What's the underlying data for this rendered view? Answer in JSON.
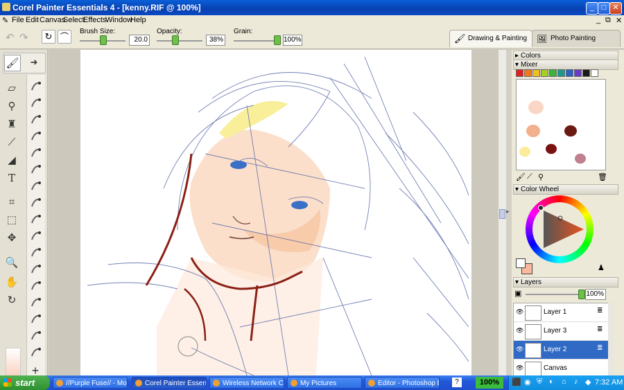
{
  "window": {
    "title": "Corel Painter Essentials 4 - [kenny.RIF @ 100%]"
  },
  "menu": [
    "File",
    "Edit",
    "Canvas",
    "Select",
    "Effects",
    "Window",
    "Help"
  ],
  "properties": {
    "brush_size_label": "Brush Size:",
    "brush_size_value": "20.0",
    "brush_size_level": 0.5,
    "opacity_label": "Opacity:",
    "opacity_value": "38%",
    "opacity_level": 0.38,
    "grain_label": "Grain:",
    "grain_value": "100%",
    "grain_level": 1.0
  },
  "workspace_tabs": [
    {
      "label": "Drawing & Painting",
      "active": true
    },
    {
      "label": "Photo Painting",
      "active": false
    }
  ],
  "tools": [
    "brush-tool-icon",
    "eraser-icon",
    "dropper-icon",
    "bucket-icon",
    "text-icon",
    "crop-icon",
    "rectangle-select-icon",
    "transform-icon",
    "magnifier-icon",
    "grabber-hand-icon",
    "rotate-page-icon"
  ],
  "panels": {
    "colors_title": "Colors",
    "mixer_title": "Mixer",
    "mixer_colors": [
      "#e02020",
      "#f07a1a",
      "#f0c020",
      "#a8d020",
      "#3cb43c",
      "#1e9a8c",
      "#2a62c8",
      "#6a3cc0",
      "#1a1a1a",
      "#ffffff"
    ],
    "mixer_blobs": [
      "#f9d7c4",
      "#f2b08e",
      "#6b1a12",
      "#7a1210",
      "#fbeb9a",
      "#c08090"
    ],
    "color_wheel_title": "Color Wheel",
    "main_color": "#e8541e",
    "secondary_color": "#f9b99e",
    "layers_title": "Layers",
    "layer_opacity": "100%",
    "layers": [
      {
        "name": "Layer 1",
        "selected": false
      },
      {
        "name": "Layer 3",
        "selected": false
      },
      {
        "name": "Layer 2",
        "selected": true
      },
      {
        "name": "Canvas",
        "selected": false
      }
    ]
  },
  "taskbar": {
    "start_label": "start",
    "tasks": [
      {
        "label": "//Purple Fuse// - Mozi...",
        "active": false
      },
      {
        "label": "Corel Painter Essenti...",
        "active": true
      },
      {
        "label": "Wireless Network Co...",
        "active": false
      },
      {
        "label": "My Pictures",
        "active": false
      },
      {
        "label": "Editor - Photoshop El...",
        "active": false
      }
    ],
    "zoom": "100%",
    "clock": "7:32 AM"
  }
}
